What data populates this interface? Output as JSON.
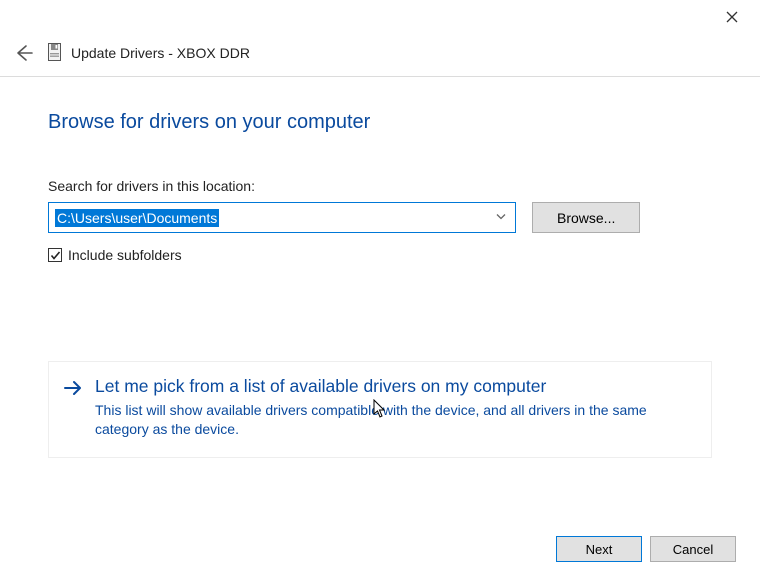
{
  "header": {
    "title": "Update Drivers - XBOX DDR"
  },
  "page": {
    "heading": "Browse for drivers on your computer",
    "search_label": "Search for drivers in this location:",
    "path_value": "C:\\Users\\user\\Documents",
    "browse_label": "Browse...",
    "include_subfolders_label": "Include subfolders",
    "include_subfolders_checked": true
  },
  "pick": {
    "title": "Let me pick from a list of available drivers on my computer",
    "description": "This list will show available drivers compatible with the device, and all drivers in the same category as the device."
  },
  "footer": {
    "next_label": "Next",
    "cancel_label": "Cancel"
  }
}
